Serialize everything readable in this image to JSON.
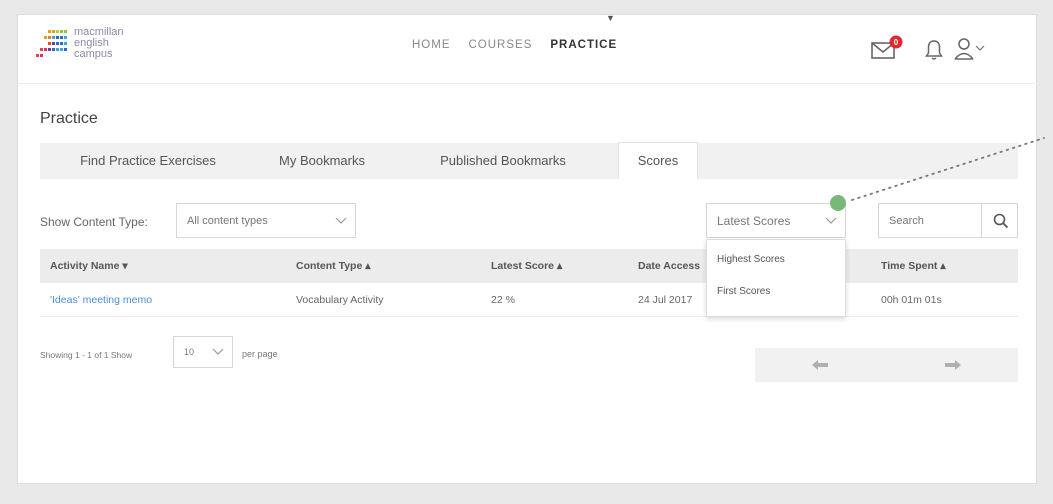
{
  "header": {
    "logo_lines": [
      "macmillan",
      "english",
      "campus"
    ],
    "nav": [
      {
        "label": "HOME"
      },
      {
        "label": "COURSES"
      },
      {
        "label": "PRACTICE"
      }
    ],
    "mail_badge": "0"
  },
  "page": {
    "title": "Practice",
    "tabs": [
      {
        "label": "Find Practice Exercises"
      },
      {
        "label": "My Bookmarks"
      },
      {
        "label": "Published Bookmarks"
      },
      {
        "label": "Scores"
      }
    ]
  },
  "filters": {
    "content_type_label": "Show Content Type:",
    "content_type_value": "All content types",
    "score_type_value": "Latest Scores",
    "score_type_options": [
      "Highest Scores",
      "First Scores"
    ],
    "search_placeholder": "Search"
  },
  "table": {
    "columns": [
      "Activity Name ▾",
      "Content Type ▴",
      "Latest Score ▴",
      "Date Access",
      "Time Spent ▴"
    ],
    "rows": [
      {
        "activity": "'Ideas' meeting memo",
        "content_type": "Vocabulary Activity",
        "score": "22 %",
        "date": "24 Jul 2017",
        "time": "00h 01m 01s"
      }
    ]
  },
  "pager": {
    "showing": "Showing 1 - 1 of 1  Show",
    "per_page_value": "10",
    "per_page_label": "per page"
  },
  "colors": {
    "accent_link": "#4a8ed6",
    "annotation": "#7ab87a",
    "badge": "#e0282e"
  }
}
